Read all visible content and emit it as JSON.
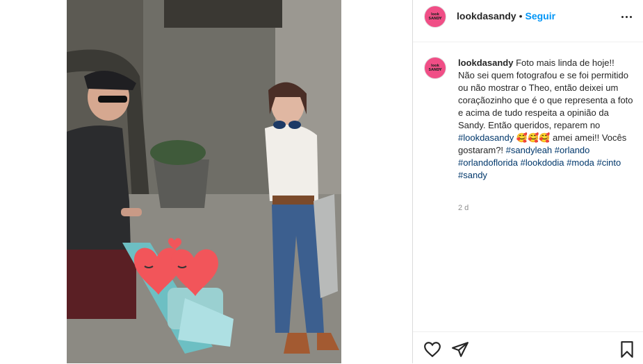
{
  "post": {
    "username": "lookdasandy",
    "follow_label": "Seguir",
    "separator": "•",
    "avatar_text_1": "look",
    "avatar_text_2": "SANDY",
    "more_icon": "more-horizontal-icon"
  },
  "caption": {
    "username": "lookdasandy",
    "text": "Foto mais linda de hoje!! Não sei quem fotografou e se foi permitido ou não mostrar o Theo, então deixei um coraçãozinho que é o que representa a foto e acima de tudo respeita a opinião da Sandy. Então queridos, reparem no ",
    "mention": "#lookdasandy",
    "emojis": "🥰🥰🥰",
    "text2": " amei amei!! Vocês gostaram?! ",
    "hashtags": [
      "#sandyleah",
      "#orlando",
      "#orlandoflorida",
      "#lookdodia",
      "#moda",
      "#cinto",
      "#sandy"
    ],
    "time": "2 d"
  },
  "actions": {
    "like_icon": "heart-icon",
    "share_icon": "paper-plane-icon",
    "save_icon": "bookmark-icon"
  },
  "colors": {
    "link": "#00376b",
    "follow": "#0095f6",
    "heart": "#f2555a",
    "avatar": "#f04e86"
  }
}
